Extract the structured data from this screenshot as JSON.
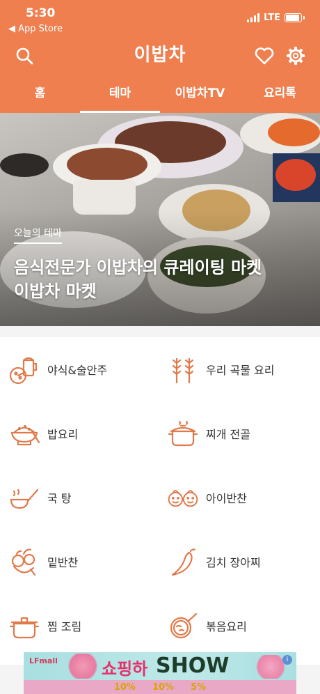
{
  "status": {
    "time": "5:30",
    "back": "◀ App Store",
    "network": "LTE"
  },
  "header": {
    "title": "이밥차"
  },
  "tabs": [
    {
      "label": "홈",
      "active": false
    },
    {
      "label": "테마",
      "active": true
    },
    {
      "label": "이밥차TV",
      "active": false
    },
    {
      "label": "요리톡",
      "active": false
    }
  ],
  "hero": {
    "tag": "오늘의 테마",
    "title_line1": "음식전문가 이밥차의 큐레이팅 마켓",
    "title_line2": "이밥차 마켓"
  },
  "menu": [
    {
      "label": "야식&술안주",
      "icon": "beer-pizza-icon"
    },
    {
      "label": "우리 곡물 요리",
      "icon": "wheat-icon"
    },
    {
      "label": "밥요리",
      "icon": "rice-bowl-icon"
    },
    {
      "label": "찌개 전골",
      "icon": "hot-pot-icon"
    },
    {
      "label": "국 탕",
      "icon": "ladle-icon"
    },
    {
      "label": "아이반찬",
      "icon": "kids-face-icon"
    },
    {
      "label": "밑반찬",
      "icon": "vegetables-icon"
    },
    {
      "label": "김치 장아찌",
      "icon": "chili-pepper-icon"
    },
    {
      "label": "찜 조림",
      "icon": "pot-icon"
    },
    {
      "label": "볶음요리",
      "icon": "frying-pan-icon"
    }
  ],
  "ad": {
    "brand": "LFmall",
    "title": "쇼핑하",
    "title2": "SHOW",
    "coupon1": "10%",
    "coupon2": "10%",
    "coupon3": "5%",
    "info": "i"
  },
  "colors": {
    "primary": "#ef7f4f",
    "icon": "#e07a4b"
  }
}
